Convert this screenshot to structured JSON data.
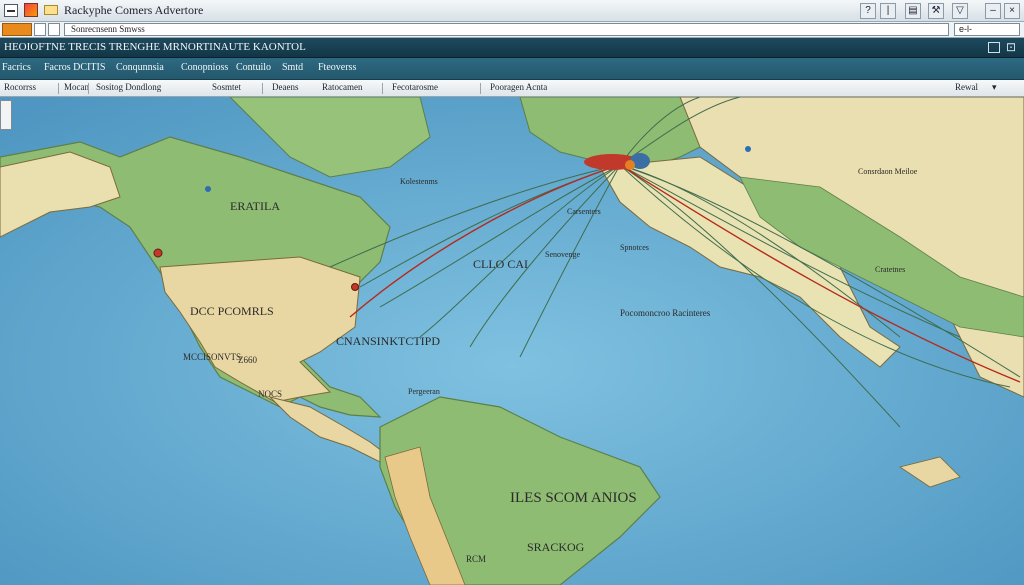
{
  "window": {
    "title": "Rackyphe Comers Advertore",
    "address": "Sonrecnsenn Smwss",
    "right_address": "e-l-"
  },
  "header": {
    "text": "HEOIOFTNE TRECIS TRENGHE MRNORTINAUTE KAONTOL",
    "menu": [
      "Facrics",
      "Facros DCITIS",
      "Conqunnsia",
      "Conopnioss",
      "Contuilo",
      "Smtd",
      "Fteoverss"
    ]
  },
  "toolbar": {
    "items": [
      "Rocorrss",
      "Mocan",
      "Sositog Dondlong",
      "Sosmtet",
      "Deaens",
      "Ratocamen",
      "Fecotarosme",
      "Pooragen Acnta",
      "Rewal"
    ]
  },
  "map": {
    "labels": {
      "na_center": "ERATILA",
      "usa_center": "DCC PCOMRLS",
      "mexico": "MCCISONVTS",
      "north_atlantic": "CLLO CAI",
      "atlantic_mid": "Senovenge",
      "caribbean_band": "CNANSINKTCTIPD",
      "south_america": "ILES SCOM ANIOS",
      "south_america_2": "SRACKOG",
      "south_america_3": "RCM",
      "europe_city": "Carsenters",
      "europe_city_2": "Spnotces",
      "med": "Kolestenms",
      "africa_note": "Pocomoncroo Racinteres",
      "east_label": "Consrdaon Meiloe",
      "east_label_2": "Cratetnes",
      "ocean_left": "NOCS",
      "pacific_code": "Z660",
      "gulf": "Pergeeran"
    },
    "colors": {
      "ocean": "#6fb3d6",
      "land_green": "#8fbc73",
      "land_tan": "#e9d7a3",
      "route": "#5a8f68",
      "route_red": "#b52a1c"
    }
  }
}
